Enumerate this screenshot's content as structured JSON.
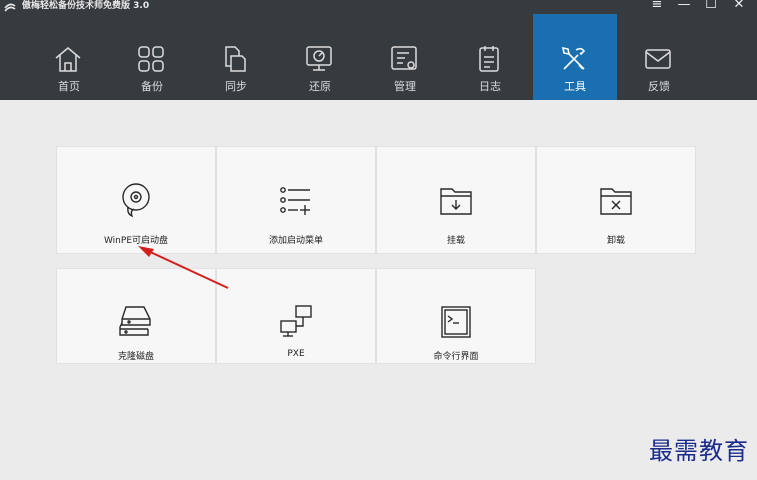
{
  "window": {
    "title": "傲梅轻松备份技术师免费版 3.0",
    "controls": {
      "menu": "≡",
      "minimize": "—",
      "maximize": "☐",
      "close": "✕"
    }
  },
  "nav": {
    "items": [
      {
        "label": "首页",
        "icon": "home-icon"
      },
      {
        "label": "备份",
        "icon": "backup-grid-icon"
      },
      {
        "label": "同步",
        "icon": "sync-icon"
      },
      {
        "label": "还原",
        "icon": "restore-icon"
      },
      {
        "label": "管理",
        "icon": "manage-icon"
      },
      {
        "label": "日志",
        "icon": "log-icon"
      },
      {
        "label": "工具",
        "icon": "tools-icon",
        "active": true
      },
      {
        "label": "反馈",
        "icon": "mail-icon"
      }
    ]
  },
  "tools": {
    "row1": [
      {
        "label": "WinPE可启动盘",
        "icon": "winpe-disc-icon"
      },
      {
        "label": "添加启动菜单",
        "icon": "boot-menu-icon"
      },
      {
        "label": "挂载",
        "icon": "mount-folder-icon"
      },
      {
        "label": "卸载",
        "icon": "unmount-folder-icon"
      }
    ],
    "row2": [
      {
        "label": "克隆磁盘",
        "icon": "clone-disk-icon"
      },
      {
        "label": "PXE",
        "icon": "pxe-network-icon"
      },
      {
        "label": "命令行界面",
        "icon": "command-line-icon"
      }
    ]
  },
  "watermark": "最需教育",
  "colors": {
    "navbar": "#363b40",
    "active": "#1a6fb0",
    "tile": "#f7f7f7",
    "arrow": "#d41f1f",
    "watermark": "#1b2b8c"
  }
}
